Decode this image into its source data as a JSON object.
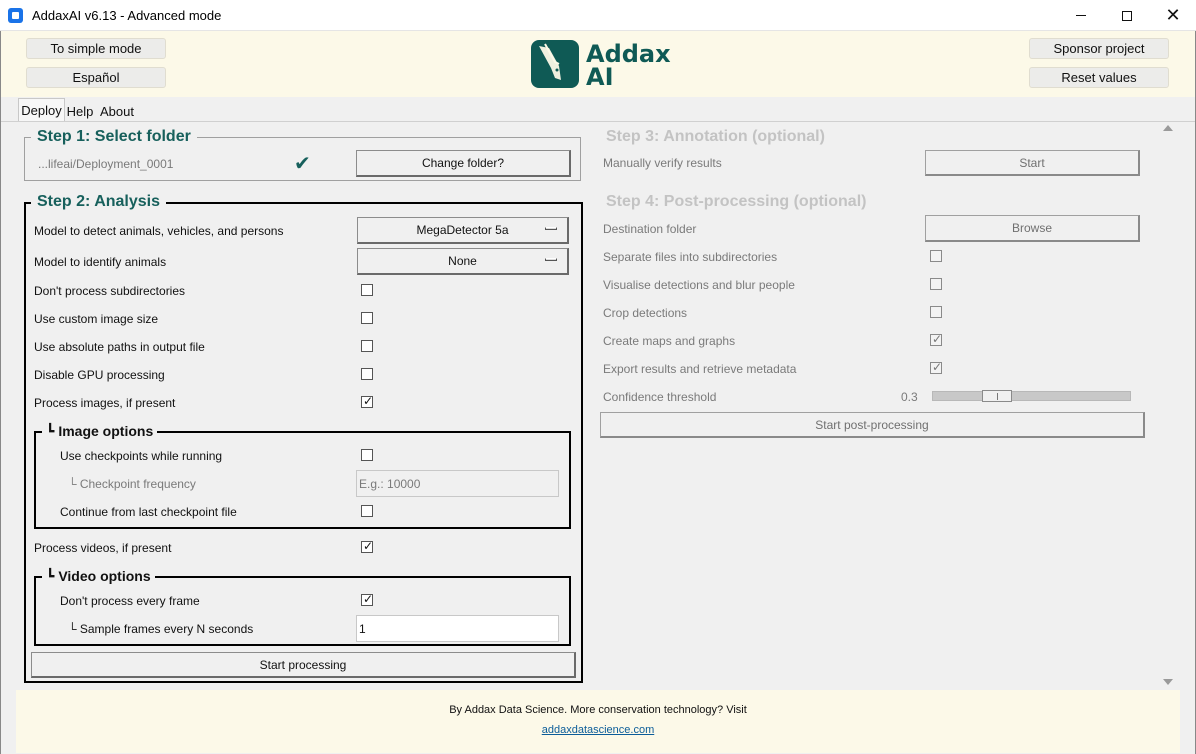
{
  "window": {
    "title": "AddaxAI v6.13 - Advanced mode",
    "minimize": "minimize",
    "maximize": "maximize",
    "close": "✕"
  },
  "header": {
    "simple_mode": "To simple mode",
    "language": "Español",
    "sponsor": "Sponsor project",
    "reset": "Reset values",
    "logo_line1": "Addax",
    "logo_line2": "AI",
    "brand_color": "#0f5a55"
  },
  "tabs": [
    {
      "label": "Deploy"
    },
    {
      "label": "Help"
    },
    {
      "label": "About"
    }
  ],
  "step1": {
    "title": "Step 1: Select folder",
    "folder_path": "...lifeai/Deployment_0001",
    "check": "✔",
    "change_button": "Change folder?"
  },
  "step2": {
    "title": "Step 2: Analysis",
    "det_model_label": "Model to detect animals, vehicles, and persons",
    "det_model_value": "MegaDetector 5a",
    "cls_model_label": "Model to identify animals",
    "cls_model_value": "None",
    "options": [
      {
        "label": "Don't process subdirectories",
        "checked": false
      },
      {
        "label": "Use custom image size",
        "checked": false
      },
      {
        "label": "Use absolute paths in output file",
        "checked": false
      },
      {
        "label": "Disable GPU processing",
        "checked": false
      },
      {
        "label": "Process images, if present",
        "checked": true
      }
    ],
    "image_options": {
      "title": "Image options",
      "checkpoints_label": "Use checkpoints while running",
      "checkpoints_checked": false,
      "frequency_label": "Checkpoint frequency",
      "frequency_placeholder": "E.g.: 10000",
      "continue_label": "Continue from last checkpoint file",
      "continue_checked": false
    },
    "process_videos_label": "Process videos, if present",
    "process_videos_checked": true,
    "video_options": {
      "title": "Video options",
      "every_frame_label": "Don't process every frame",
      "every_frame_checked": true,
      "sample_label": "Sample frames every N seconds",
      "sample_value": "1"
    },
    "start_button": "Start processing"
  },
  "step3": {
    "title": "Step 3: Annotation (optional)",
    "verify_label": "Manually verify results",
    "start_button": "Start"
  },
  "step4": {
    "title": "Step 4: Post-processing (optional)",
    "destination_label": "Destination folder",
    "browse_button": "Browse",
    "options": [
      {
        "label": "Separate files into subdirectories",
        "checked": false
      },
      {
        "label": "Visualise detections and blur people",
        "checked": false
      },
      {
        "label": "Crop detections",
        "checked": false
      },
      {
        "label": "Create maps and graphs",
        "checked": true
      },
      {
        "label": "Export results and retrieve metadata",
        "checked": true
      }
    ],
    "confidence_label": "Confidence threshold",
    "confidence_value": "0.3",
    "start_button": "Start post-processing"
  },
  "footer": {
    "text": "By Addax Data Science. More conservation technology? Visit",
    "link": "addaxdatascience.com"
  }
}
